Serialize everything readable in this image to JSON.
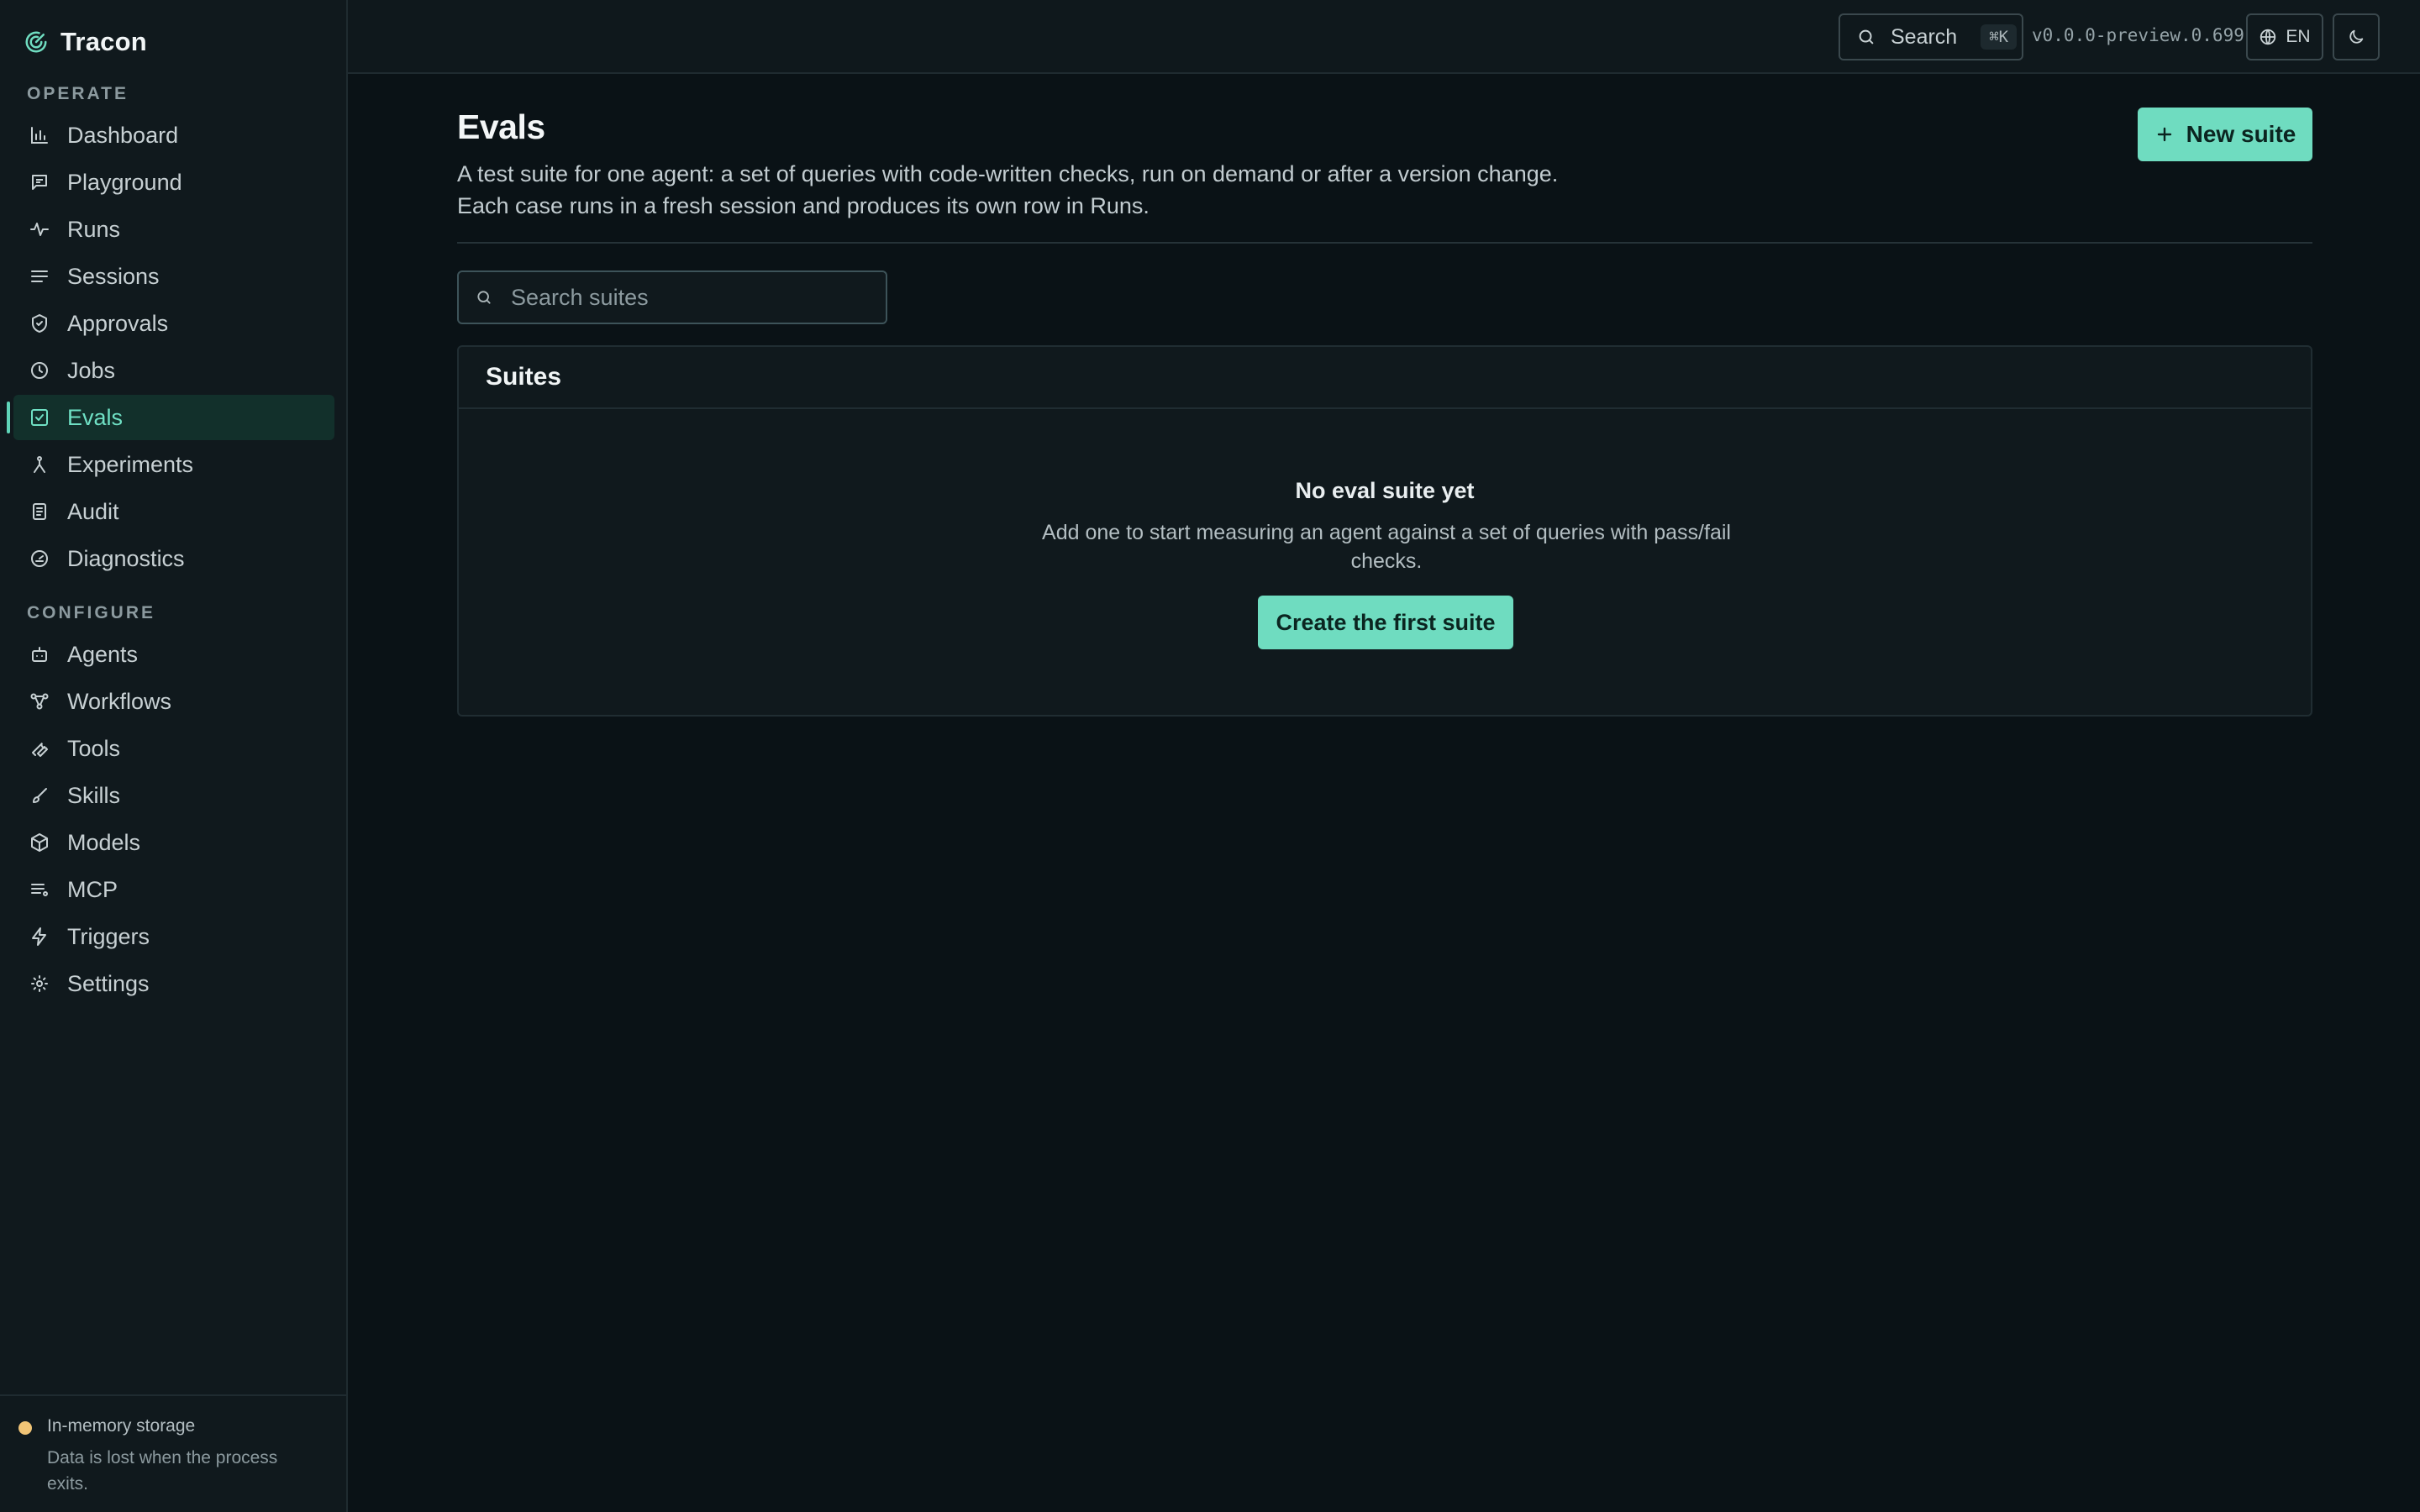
{
  "app": {
    "name": "Tracon",
    "version": "v0.0.0-preview.0.699",
    "accent_color": "#6fdcc0"
  },
  "topbar": {
    "search_label": "Search",
    "search_shortcut": "⌘K",
    "language": "EN",
    "icons": [
      "search-icon",
      "globe-icon",
      "moon-icon"
    ]
  },
  "sidebar": {
    "sections": [
      {
        "label": "OPERATE",
        "items": [
          {
            "label": "Dashboard",
            "icon": "bar-chart-icon"
          },
          {
            "label": "Playground",
            "icon": "chat-icon"
          },
          {
            "label": "Runs",
            "icon": "activity-icon"
          },
          {
            "label": "Sessions",
            "icon": "list-icon"
          },
          {
            "label": "Approvals",
            "icon": "shield-check-icon"
          },
          {
            "label": "Jobs",
            "icon": "clock-icon"
          },
          {
            "label": "Evals",
            "icon": "checkbox-icon",
            "active": true
          },
          {
            "label": "Experiments",
            "icon": "fork-icon"
          },
          {
            "label": "Audit",
            "icon": "clipboard-icon"
          },
          {
            "label": "Diagnostics",
            "icon": "gauge-icon"
          }
        ]
      },
      {
        "label": "CONFIGURE",
        "items": [
          {
            "label": "Agents",
            "icon": "bot-icon"
          },
          {
            "label": "Workflows",
            "icon": "workflow-icon"
          },
          {
            "label": "Tools",
            "icon": "wrench-icon"
          },
          {
            "label": "Skills",
            "icon": "brush-icon"
          },
          {
            "label": "Models",
            "icon": "cube-icon"
          },
          {
            "label": "MCP",
            "icon": "server-list-icon"
          },
          {
            "label": "Triggers",
            "icon": "zap-icon"
          },
          {
            "label": "Settings",
            "icon": "sun-gear-icon"
          }
        ]
      }
    ],
    "footer": {
      "status_title": "In-memory storage",
      "status_note": "Data is lost when the process exits.",
      "status_color": "#f0c476"
    }
  },
  "main": {
    "title": "Evals",
    "description_line1": "A test suite for one agent: a set of queries with code-written checks, run on demand or after a version change.",
    "description_line2": "Each case runs in a fresh session and produces its own row in Runs.",
    "new_button": "New suite",
    "search_placeholder": "Search suites",
    "panel": {
      "title": "Suites",
      "empty_title": "No eval suite yet",
      "empty_description": "Add one to start measuring an agent against a set of queries with pass/fail checks.",
      "empty_cta": "Create the first suite"
    }
  }
}
